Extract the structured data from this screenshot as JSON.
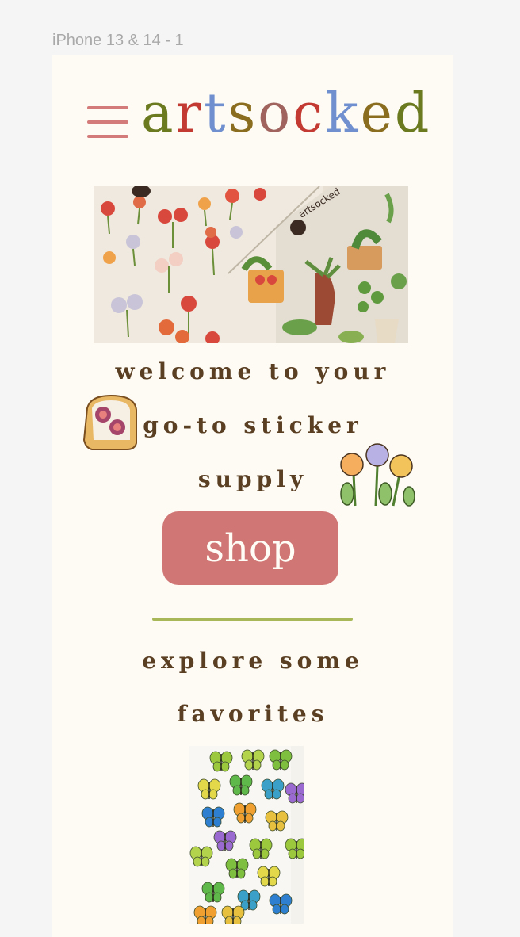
{
  "frame": {
    "title": "iPhone 13 & 14 - 1"
  },
  "header": {
    "menu_icon": "hamburger-menu-icon",
    "logo_letters": [
      {
        "ch": "a",
        "color": "#6b7a1f"
      },
      {
        "ch": "r",
        "color": "#c33a33"
      },
      {
        "ch": "t",
        "color": "#6f8fcf"
      },
      {
        "ch": "s",
        "color": "#8a6d1e"
      },
      {
        "ch": "o",
        "color": "#a0635e"
      },
      {
        "ch": "c",
        "color": "#c33a33"
      },
      {
        "ch": "k",
        "color": "#6f8fcf"
      },
      {
        "ch": "e",
        "color": "#8a6d1e"
      },
      {
        "ch": "d",
        "color": "#6b7a1f"
      }
    ],
    "menu_color": "#d37a7a"
  },
  "hero": {
    "image": "sticker-sheet-photo",
    "package_label": "artsocked"
  },
  "welcome": {
    "line1": "welcome to your",
    "line2": "go-to sticker",
    "line3": "supply"
  },
  "shop_button": {
    "label": "shop",
    "color": "#d07675"
  },
  "favorites": {
    "line1": "explore some",
    "line2": "favorites",
    "product_image": "butterfly-sticker-sheet"
  },
  "colors": {
    "text": "#5a3f23",
    "divider": "#a8b858",
    "background": "#fdfbf4"
  }
}
